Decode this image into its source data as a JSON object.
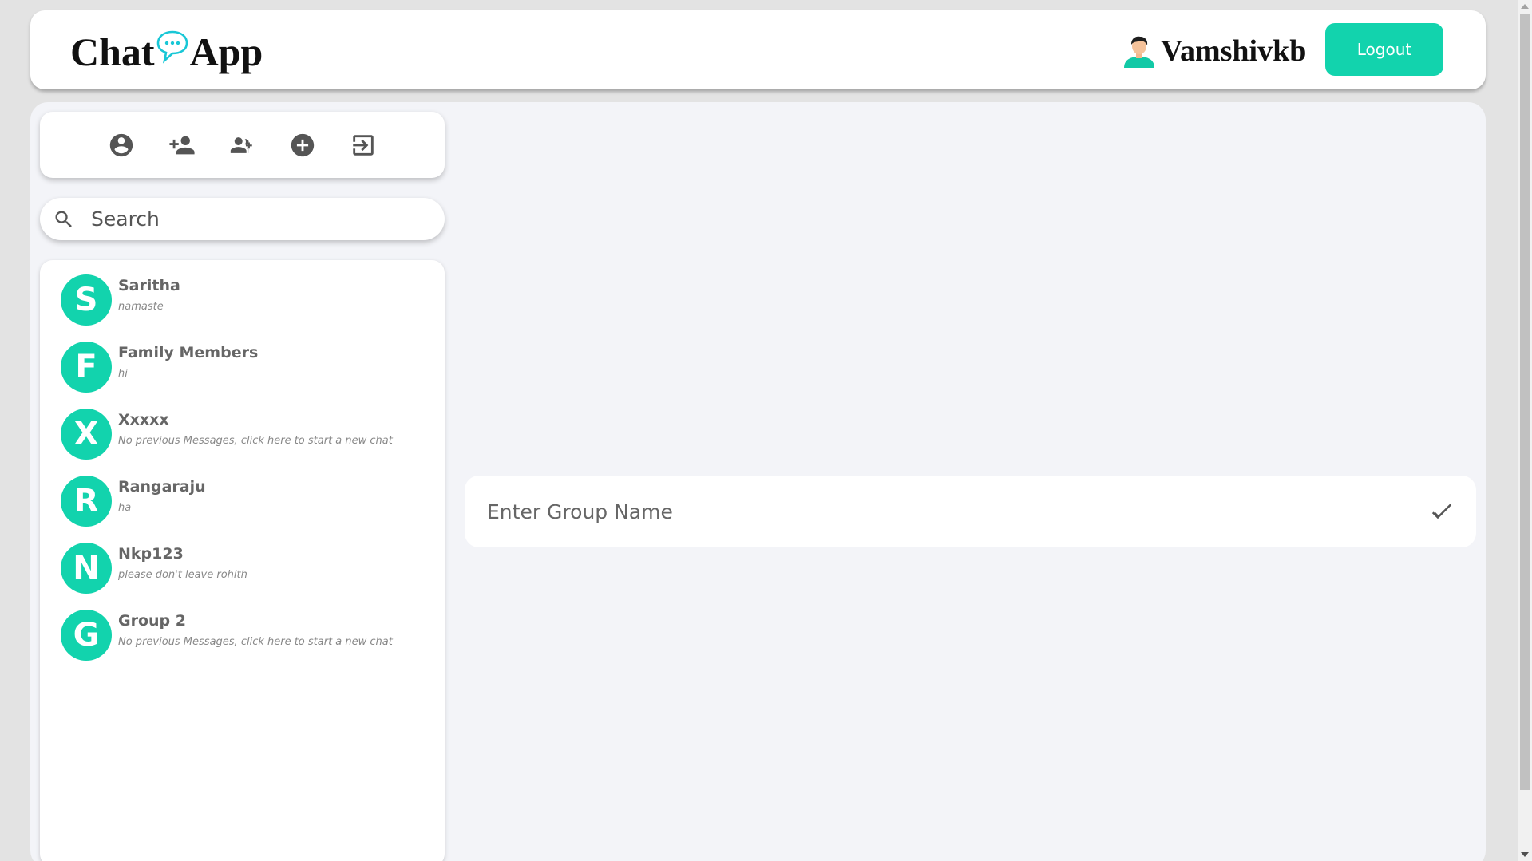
{
  "header": {
    "logo_left": "Chat",
    "logo_right": "App",
    "username": "Vamshivkb",
    "logout_label": "Logout"
  },
  "toolbar": {
    "icons": [
      "profile-icon",
      "add-person-icon",
      "add-group-icon",
      "add-circle-icon",
      "exit-icon"
    ]
  },
  "search": {
    "placeholder": "Search"
  },
  "chats": [
    {
      "initial": "S",
      "name": "Saritha",
      "last_message": "namaste"
    },
    {
      "initial": "F",
      "name": "Family Members",
      "last_message": "hi"
    },
    {
      "initial": "X",
      "name": "Xxxxx",
      "last_message": "No previous Messages, click here to start a new chat"
    },
    {
      "initial": "R",
      "name": "Rangaraju",
      "last_message": "ha"
    },
    {
      "initial": "N",
      "name": "Nkp123",
      "last_message": "please don't leave rohith"
    },
    {
      "initial": "G",
      "name": "Group 2",
      "last_message": "No previous Messages, click here to start a new chat"
    }
  ],
  "group_form": {
    "placeholder": "Enter Group Name"
  },
  "colors": {
    "accent": "#12d3ad",
    "panel_bg": "#f3f4f8",
    "page_bg": "#e3e3e3"
  }
}
